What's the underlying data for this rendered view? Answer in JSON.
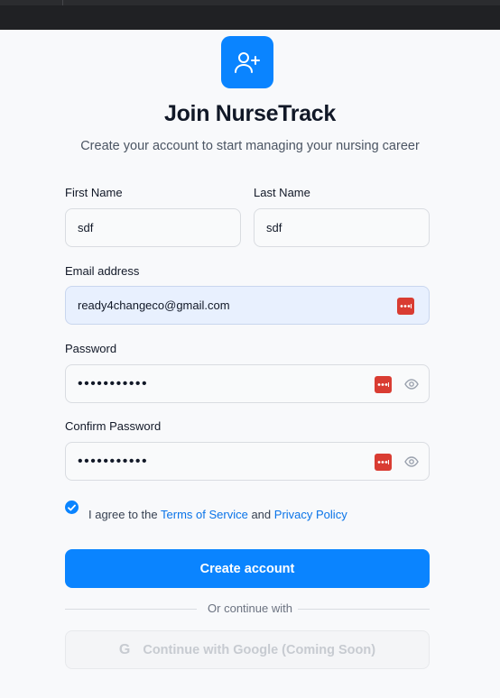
{
  "page": {
    "title": "Join NurseTrack",
    "subtitle": "Create your account to start managing your nursing career"
  },
  "form": {
    "first_name_label": "First Name",
    "first_name_value": "sdf",
    "last_name_label": "Last Name",
    "last_name_value": "sdf",
    "email_label": "Email address",
    "email_value": "ready4changeco@gmail.com",
    "password_label": "Password",
    "password_value": "•••••••••••",
    "confirm_label": "Confirm Password",
    "confirm_value": "•••••••••••",
    "agree_prefix": "I agree to the",
    "terms_link": "Terms of Service",
    "agree_and": "and",
    "privacy_link": "Privacy Policy",
    "agree_checked": true,
    "submit_label": "Create account",
    "divider_text": "Or continue with",
    "google_label": "Continue with Google (Coming Soon)",
    "google_icon_text": "G"
  },
  "icons": {
    "logo": "user-plus-icon",
    "password_manager": "password-manager-icon",
    "show_password": "eye-icon",
    "check": "check-icon",
    "google": "google-icon"
  },
  "colors": {
    "accent": "#0a84ff",
    "password_manager_badge": "#d93c32",
    "autofill_background": "#e8f0fe"
  }
}
